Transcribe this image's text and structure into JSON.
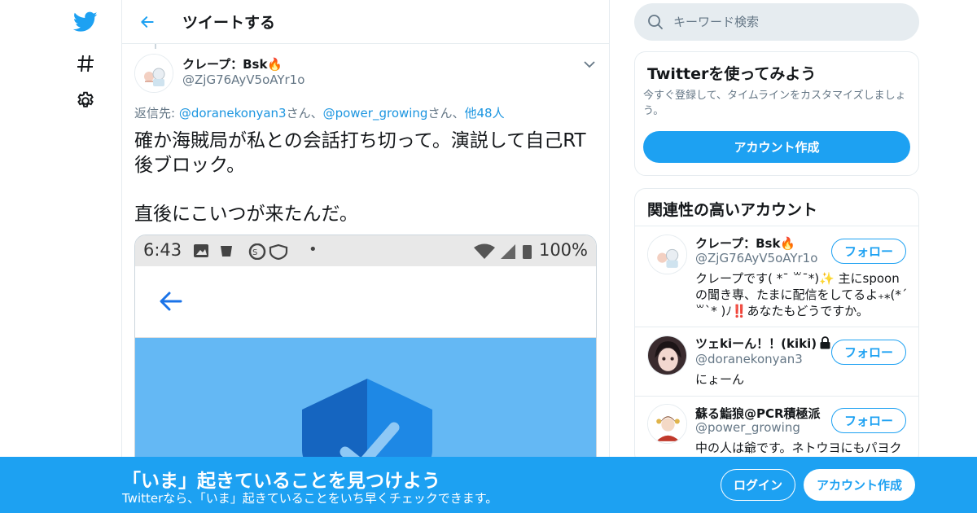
{
  "nav": {
    "icons": [
      "twitter-bird-icon",
      "hashtag-icon",
      "gear-icon"
    ]
  },
  "header": {
    "title": "ツイートする"
  },
  "tweet": {
    "author_name": "クレープ：Bsk🔥",
    "author_handle": "@ZjG76AyV5oAYr1o",
    "replying_prefix": "返信先: ",
    "replying_to": [
      {
        "handle": "@doranekonyan3",
        "suffix": "さん、"
      },
      {
        "handle": "@power_growing",
        "suffix": "さん、"
      }
    ],
    "replying_more": "他48人",
    "text_lines": [
      "確か海賊局が私との会話打ち切って。演説して自己RT",
      "後ブロック。",
      "",
      "直後にこいつが来たんだ。"
    ],
    "media": {
      "status_time": "6:43",
      "status_battery": "100%",
      "status_dot": "•"
    }
  },
  "search": {
    "placeholder": "キーワード検索"
  },
  "signup_card": {
    "title": "Twitterを使ってみよう",
    "description": "今すぐ登録して、タイムラインをカスタマイズしましょう。",
    "button": "アカウント作成"
  },
  "related": {
    "title": "関連性の高いアカウント",
    "accounts": [
      {
        "name": "クレープ：Bsk🔥",
        "handle": "@ZjG76AyV5oAYr1o",
        "bio": "クレープです( *¯ ꒳¯*)✨ 主にspoonの聞き専、たまに配信をしてるよ₊⁎(*ˊ꒳ˋ* )ﾉ‼️あなたもどうですか。",
        "follow": "フォロー"
      },
      {
        "name": "ツェkiーん！！(kiki)",
        "handle": "@doranekonyan3",
        "bio": "にょーん",
        "follow": "フォロー"
      },
      {
        "name": "蘇る鮨狼@PCR積極派",
        "handle": "@power_growing",
        "bio": "中の人は爺です。ネトウヨにもパヨク",
        "follow": "フォロー"
      }
    ]
  },
  "bottombar": {
    "title": "「いま」起きていることを見つけよう",
    "subtitle": "Twitterなら、「いま」起きていることをいち早くチェックできます。",
    "login": "ログイン",
    "signup": "アカウント作成"
  },
  "colors": {
    "accent": "#1da1f2",
    "link": "#1b95e0",
    "secondary_text": "#657786",
    "border": "#e6ecf0"
  }
}
